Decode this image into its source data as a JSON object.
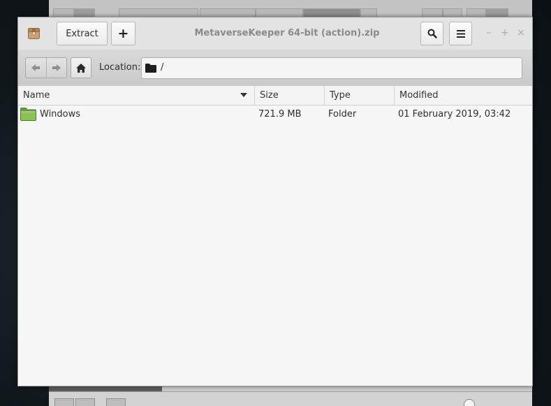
{
  "window": {
    "title": "MetaverseKeeper 64-bit (action).zip"
  },
  "toolbar": {
    "extract_label": "Extract",
    "add_label": "+",
    "icons": {
      "app": "archive-icon",
      "search": "search-icon",
      "menu": "hamburger-menu-icon"
    }
  },
  "window_controls": {
    "minimize": "–",
    "maximize": "+",
    "close": "×"
  },
  "location": {
    "label": "Location:",
    "value": "/"
  },
  "table": {
    "columns": [
      "Name",
      "Size",
      "Type",
      "Modified"
    ],
    "sorted_by": "Name",
    "rows": [
      {
        "name": "Windows",
        "size": "721.9 MB",
        "type": "Folder",
        "modified": "01 February 2019, 03:42",
        "icon": "folder-icon"
      }
    ]
  },
  "colors": {
    "folder_green": "#7fb24f",
    "window_bg": "#f7f7f7"
  }
}
